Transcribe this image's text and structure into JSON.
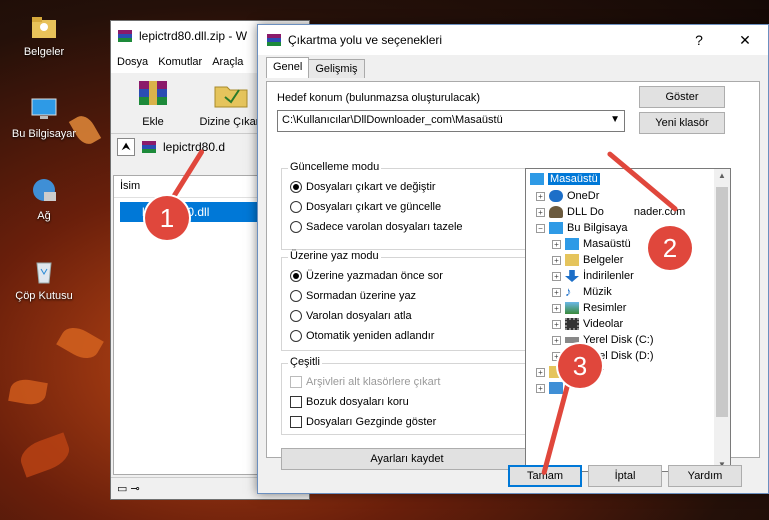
{
  "desktop": {
    "icons": [
      {
        "label": "Belgeler",
        "icon": "documents-folder-icon"
      },
      {
        "label": "Bu Bilgisayar",
        "icon": "computer-icon"
      },
      {
        "label": "Ağ",
        "icon": "network-icon"
      },
      {
        "label": "Çöp Kutusu",
        "icon": "recycle-bin-icon"
      }
    ]
  },
  "winrar": {
    "title": "lepictrd80.dll.zip - W",
    "menu": [
      "Dosya",
      "Komutlar",
      "Araçla"
    ],
    "toolbar": {
      "add_label": "Ekle",
      "extract_label": "Dizine Çıkart"
    },
    "path": "lepictrd80.d",
    "column_name": "İsim",
    "file": "lepictrd80.dll"
  },
  "dialog": {
    "title": "Çıkartma yolu ve seçenekleri",
    "help_glyph": "?",
    "close_glyph": "✕",
    "tabs": [
      "Genel",
      "Gelişmiş"
    ],
    "dest_label": "Hedef konum (bulunmazsa oluşturulacak)",
    "dest_value": "C:\\Kullanıcılar\\DllDownloader_com\\Masaüstü",
    "show_button": "Göster",
    "new_folder_button": "Yeni klasör",
    "update_mode": {
      "title": "Güncelleme modu",
      "options": [
        "Dosyaları çıkart ve değiştir",
        "Dosyaları çıkart ve güncelle",
        "Sadece varolan dosyaları tazele"
      ],
      "selected": 0
    },
    "overwrite_mode": {
      "title": "Üzerine yaz modu",
      "options": [
        "Üzerine yazmadan önce sor",
        "Sormadan üzerine yaz",
        "Varolan dosyaları atla",
        "Otomatik yeniden adlandır"
      ],
      "selected": 0
    },
    "misc": {
      "title": "Çeşitli",
      "options": [
        "Arşivleri alt klasörlere çıkart",
        "Bozuk dosyaları koru",
        "Dosyaları Gezginde göster"
      ]
    },
    "save_settings_button": "Ayarları kaydet",
    "tree": [
      {
        "label": "Masaüstü",
        "selected": true
      },
      {
        "label": "OneDr"
      },
      {
        "label": "DLL Do",
        "suffix": "nader.com"
      },
      {
        "label": "Bu Bilgisaya"
      },
      {
        "label": "Masaüstü"
      },
      {
        "label": "Belgeler"
      },
      {
        "label": "İndirilenler"
      },
      {
        "label": "Müzik"
      },
      {
        "label": "Resimler"
      },
      {
        "label": "Videolar"
      },
      {
        "label": "Yerel Disk (C:)"
      },
      {
        "label": "Yerel Disk (D:)"
      },
      {
        "label": "K",
        "suffix": "klar"
      },
      {
        "label": ""
      }
    ],
    "ok_button": "Tamam",
    "cancel_button": "İptal",
    "help_button": "Yardım"
  },
  "annotations": [
    "1",
    "2",
    "3"
  ],
  "colors": {
    "accent": "#0078d7",
    "annotation": "#e0473c"
  }
}
